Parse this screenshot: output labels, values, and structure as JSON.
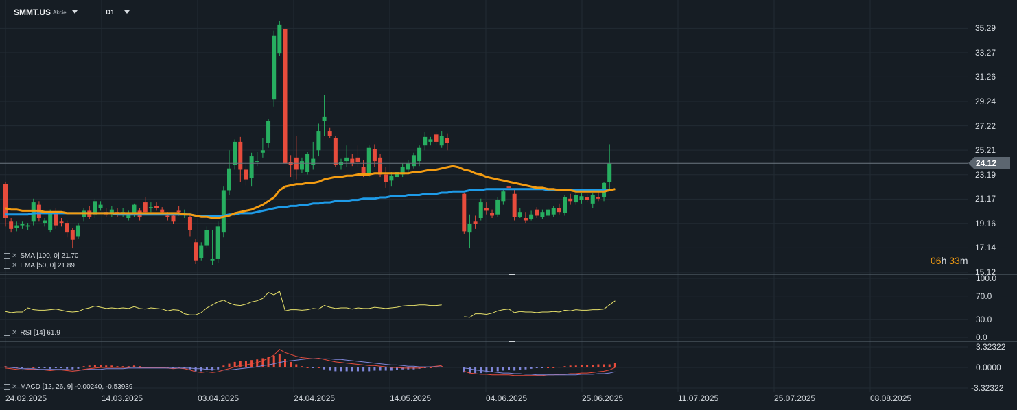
{
  "header": {
    "symbol": "SMMT.US",
    "symbol_type": "Akcie",
    "timeframe": "D1",
    "countdown_hours": "06",
    "countdown_h_unit": "h",
    "countdown_minutes": "33",
    "countdown_m_unit": "m"
  },
  "indicators": {
    "sma": "SMA [100, 0] 21.70",
    "ema": "EMA [50, 0] 21.89",
    "rsi": "RSI [14] 61.9",
    "macd": "MACD [12, 26, 9] -0.00240, -0.53939"
  },
  "colors": {
    "background": "#161d24",
    "up": "#27ae60",
    "down": "#e74c3c",
    "sma": "#1e9be8",
    "ema": "#f39c12",
    "rsi": "#e6e06a",
    "macd_line": "#e74c3c",
    "signal_line": "#7f86d9",
    "grid": "#222b33",
    "current_price_line": "#6c7780"
  },
  "chart_data": {
    "type": "candlestick",
    "symbol": "SMMT.US",
    "timeframe": "D1",
    "price_axis": {
      "ticks": [
        35.29,
        33.27,
        31.26,
        29.24,
        27.22,
        25.21,
        23.19,
        21.17,
        19.16,
        17.14,
        15.12
      ],
      "range": [
        15.12,
        36.5
      ],
      "current_price": 24.12
    },
    "date_axis": {
      "labels": [
        "24.02.2025",
        "14.03.2025",
        "03.04.2025",
        "24.04.2025",
        "14.05.2025",
        "04.06.2025",
        "25.06.2025",
        "11.07.2025",
        "25.07.2025",
        "08.08.2025"
      ]
    },
    "candles": [
      [
        22.4,
        22.6,
        18.9,
        19.6
      ],
      [
        19.3,
        19.6,
        18.4,
        18.7
      ],
      [
        18.8,
        19.3,
        18.5,
        19.0
      ],
      [
        19.0,
        19.3,
        18.7,
        19.1
      ],
      [
        18.9,
        19.2,
        18.6,
        19.0
      ],
      [
        19.3,
        21.2,
        19.0,
        20.9
      ],
      [
        20.7,
        21.0,
        19.3,
        19.6
      ],
      [
        19.2,
        19.6,
        18.9,
        19.4
      ],
      [
        18.6,
        20.3,
        18.4,
        20.0
      ],
      [
        20.1,
        20.4,
        18.7,
        19.0
      ],
      [
        19.3,
        19.6,
        18.9,
        19.2
      ],
      [
        19.2,
        19.4,
        18.0,
        18.4
      ],
      [
        18.6,
        18.8,
        17.1,
        17.8
      ],
      [
        18.1,
        19.2,
        17.9,
        19.0
      ],
      [
        19.7,
        20.4,
        19.3,
        20.2
      ],
      [
        20.2,
        20.6,
        19.5,
        19.7
      ],
      [
        19.9,
        21.2,
        19.6,
        21.0
      ],
      [
        20.4,
        21.0,
        20.2,
        20.7
      ],
      [
        20.1,
        20.4,
        19.7,
        19.9
      ],
      [
        20.0,
        20.6,
        19.7,
        20.3
      ],
      [
        20.1,
        20.4,
        19.7,
        19.9
      ],
      [
        19.9,
        20.4,
        19.7,
        20.1
      ],
      [
        19.6,
        20.2,
        19.4,
        20.0
      ],
      [
        19.9,
        20.8,
        19.7,
        20.7
      ],
      [
        20.2,
        20.4,
        19.4,
        19.7
      ],
      [
        20.9,
        21.3,
        19.9,
        20.1
      ],
      [
        20.4,
        20.9,
        20.1,
        20.5
      ],
      [
        20.6,
        20.9,
        20.2,
        20.4
      ],
      [
        20.3,
        20.5,
        19.9,
        20.1
      ],
      [
        19.8,
        20.1,
        19.4,
        19.7
      ],
      [
        19.8,
        20.0,
        19.1,
        19.3
      ],
      [
        20.2,
        20.6,
        19.8,
        20.1
      ],
      [
        19.9,
        20.3,
        19.6,
        20.0
      ],
      [
        19.7,
        19.9,
        18.1,
        18.6
      ],
      [
        17.6,
        17.9,
        15.8,
        16.1
      ],
      [
        16.3,
        17.6,
        16.1,
        17.3
      ],
      [
        17.3,
        18.9,
        17.1,
        18.6
      ],
      [
        16.1,
        18.6,
        15.7,
        16.2
      ],
      [
        16.2,
        19.3,
        15.9,
        18.9
      ],
      [
        18.4,
        22.2,
        18.0,
        21.9
      ],
      [
        21.9,
        25.2,
        21.5,
        23.7
      ],
      [
        24.0,
        26.1,
        23.6,
        25.9
      ],
      [
        25.9,
        26.3,
        22.6,
        23.6
      ],
      [
        23.6,
        24.2,
        22.3,
        22.8
      ],
      [
        22.9,
        25.0,
        22.2,
        24.7
      ],
      [
        24.2,
        25.1,
        23.9,
        24.3
      ],
      [
        25.0,
        26.2,
        24.6,
        25.2
      ],
      [
        25.8,
        27.8,
        25.4,
        27.6
      ],
      [
        29.4,
        35.1,
        28.8,
        34.7
      ],
      [
        33.2,
        35.9,
        33.0,
        35.6
      ],
      [
        35.2,
        35.6,
        23.7,
        24.1
      ],
      [
        24.2,
        24.8,
        23.0,
        24.0
      ],
      [
        24.6,
        26.4,
        22.8,
        23.6
      ],
      [
        23.6,
        24.6,
        23.3,
        24.3
      ],
      [
        23.4,
        25.1,
        23.2,
        24.9
      ],
      [
        24.0,
        25.9,
        23.6,
        24.5
      ],
      [
        25.2,
        27.4,
        24.7,
        26.8
      ],
      [
        27.6,
        29.8,
        26.4,
        28.0
      ],
      [
        26.8,
        27.1,
        26.2,
        26.4
      ],
      [
        26.2,
        26.4,
        23.8,
        24.0
      ],
      [
        24.0,
        24.5,
        23.6,
        24.2
      ],
      [
        24.3,
        25.6,
        23.8,
        24.6
      ],
      [
        24.5,
        24.9,
        23.9,
        24.1
      ],
      [
        24.6,
        25.6,
        23.8,
        24.2
      ],
      [
        23.8,
        24.4,
        23.0,
        23.3
      ],
      [
        23.3,
        25.6,
        23.0,
        25.4
      ],
      [
        25.3,
        25.7,
        23.8,
        24.3
      ],
      [
        24.6,
        24.9,
        23.0,
        23.2
      ],
      [
        23.2,
        23.8,
        22.1,
        22.6
      ],
      [
        22.7,
        23.4,
        22.2,
        23.1
      ],
      [
        23.0,
        23.7,
        22.6,
        23.4
      ],
      [
        23.2,
        24.1,
        23.0,
        23.8
      ],
      [
        23.6,
        24.4,
        23.2,
        24.1
      ],
      [
        23.9,
        25.0,
        23.7,
        24.8
      ],
      [
        24.3,
        25.6,
        23.9,
        25.4
      ],
      [
        25.6,
        26.7,
        25.2,
        26.3
      ],
      [
        25.9,
        26.3,
        25.6,
        26.1
      ],
      [
        26.5,
        26.7,
        25.6,
        25.9
      ],
      [
        25.6,
        26.8,
        25.4,
        26.4
      ],
      [
        26.2,
        26.6,
        25.2,
        25.8
      ],
      [
        null,
        null,
        null,
        null
      ],
      [
        null,
        null,
        null,
        null
      ],
      [
        21.6,
        21.7,
        18.3,
        18.5
      ],
      [
        18.4,
        19.9,
        17.1,
        19.1
      ],
      [
        19.3,
        19.8,
        18.7,
        19.1
      ],
      [
        19.6,
        21.2,
        19.4,
        20.9
      ],
      [
        20.4,
        20.9,
        19.9,
        20.2
      ],
      [
        20.0,
        20.3,
        19.6,
        19.8
      ],
      [
        19.9,
        21.3,
        19.7,
        21.1
      ],
      [
        21.0,
        22.0,
        20.7,
        21.8
      ],
      [
        22.2,
        22.8,
        21.8,
        22.1
      ],
      [
        21.6,
        22.0,
        19.4,
        19.7
      ],
      [
        19.7,
        20.4,
        19.6,
        20.1
      ],
      [
        19.6,
        20.1,
        19.2,
        19.4
      ],
      [
        19.5,
        20.2,
        19.4,
        19.9
      ],
      [
        20.3,
        20.5,
        19.6,
        19.8
      ],
      [
        19.7,
        20.3,
        19.5,
        20.1
      ],
      [
        19.8,
        20.4,
        19.6,
        20.3
      ],
      [
        19.9,
        20.6,
        19.7,
        20.4
      ],
      [
        20.4,
        20.8,
        19.9,
        20.1
      ],
      [
        20.0,
        21.5,
        19.8,
        21.3
      ],
      [
        21.2,
        21.6,
        20.7,
        21.0
      ],
      [
        20.9,
        21.8,
        20.7,
        21.5
      ],
      [
        21.1,
        21.7,
        20.8,
        21.4
      ],
      [
        21.3,
        21.6,
        20.9,
        21.1
      ],
      [
        20.8,
        21.7,
        20.4,
        21.5
      ],
      [
        21.3,
        21.8,
        21.0,
        21.2
      ],
      [
        21.3,
        22.6,
        21.0,
        22.5
      ],
      [
        22.6,
        25.7,
        22.0,
        24.1
      ]
    ],
    "sma100": [
      19.9,
      19.9,
      19.9,
      19.9,
      19.9,
      20.0,
      20.0,
      20.0,
      20.0,
      20.0,
      20.0,
      20.0,
      20.0,
      20.0,
      20.0,
      20.0,
      20.0,
      20.0,
      20.0,
      20.0,
      19.9,
      19.9,
      19.9,
      19.9,
      19.9,
      19.9,
      19.9,
      19.9,
      19.9,
      19.9,
      19.9,
      19.9,
      19.9,
      19.9,
      19.8,
      19.8,
      19.8,
      19.8,
      19.8,
      19.8,
      19.9,
      19.9,
      20.0,
      20.0,
      20.0,
      20.1,
      20.2,
      20.3,
      20.4,
      20.5,
      20.5,
      20.6,
      20.6,
      20.7,
      20.7,
      20.8,
      20.8,
      20.9,
      20.9,
      21.0,
      21.0,
      21.0,
      21.1,
      21.1,
      21.2,
      21.2,
      21.2,
      21.3,
      21.3,
      21.4,
      21.4,
      21.4,
      21.5,
      21.5,
      21.5,
      21.6,
      21.6,
      21.6,
      21.7,
      21.7,
      21.8,
      21.8,
      21.8,
      21.9,
      21.9,
      21.9,
      22.0,
      22.0,
      22.0,
      22.0,
      22.0,
      22.0,
      22.0,
      22.0,
      22.0,
      22.0,
      22.0,
      21.9,
      21.9,
      21.9,
      21.9,
      21.9,
      21.9,
      21.9,
      21.9,
      21.9,
      21.9,
      21.9,
      21.9
    ],
    "ema50": [
      20.4,
      20.3,
      20.3,
      20.2,
      20.2,
      20.2,
      20.2,
      20.1,
      20.1,
      20.1,
      20.1,
      20.0,
      20.0,
      20.0,
      20.0,
      20.0,
      20.0,
      20.0,
      20.0,
      20.0,
      20.0,
      20.0,
      20.0,
      20.0,
      20.0,
      20.0,
      20.0,
      20.0,
      20.0,
      20.0,
      20.0,
      20.0,
      19.9,
      19.9,
      19.8,
      19.7,
      19.7,
      19.6,
      19.6,
      19.7,
      19.8,
      20.0,
      20.1,
      20.2,
      20.3,
      20.5,
      20.7,
      21.0,
      21.3,
      21.9,
      22.2,
      22.3,
      22.4,
      22.4,
      22.5,
      22.5,
      22.6,
      22.8,
      22.9,
      23.0,
      23.0,
      23.1,
      23.1,
      23.2,
      23.2,
      23.2,
      23.3,
      23.3,
      23.3,
      23.3,
      23.3,
      23.3,
      23.3,
      23.4,
      23.4,
      23.5,
      23.6,
      23.6,
      23.7,
      23.8,
      23.9,
      23.8,
      23.6,
      23.5,
      23.3,
      23.2,
      23.0,
      22.9,
      22.8,
      22.7,
      22.6,
      22.5,
      22.4,
      22.3,
      22.2,
      22.1,
      22.1,
      22.0,
      22.0,
      21.9,
      21.9,
      21.9,
      21.8,
      21.8,
      21.8,
      21.8,
      21.8,
      21.8,
      21.9,
      22.0
    ],
    "rsi": [
      44,
      42,
      43,
      43,
      50,
      47,
      46,
      46,
      47,
      48,
      46,
      44,
      43,
      44,
      48,
      50,
      53,
      51,
      49,
      50,
      49,
      50,
      49,
      52,
      49,
      48,
      50,
      49,
      48,
      45,
      47,
      46,
      40,
      38,
      38,
      42,
      50,
      55,
      60,
      63,
      58,
      55,
      54,
      56,
      60,
      62,
      66,
      76,
      72,
      78,
      45,
      47,
      47,
      46,
      47,
      49,
      48,
      54,
      51,
      49,
      50,
      50,
      48,
      50,
      49,
      49,
      51,
      50,
      49,
      50,
      51,
      53,
      54,
      54,
      55,
      55,
      54,
      54,
      55,
      null,
      null,
      null,
      35,
      34,
      40,
      40,
      39,
      41,
      45,
      47,
      48,
      42,
      44,
      43,
      43,
      42,
      43,
      43,
      44,
      43,
      46,
      45,
      47,
      46,
      46,
      47,
      47,
      48,
      55,
      61.9
    ],
    "rsi_axis": [
      100.0,
      70.0,
      30.0,
      0.0
    ],
    "macd_axis": [
      3.32322,
      0.0,
      -3.32322
    ],
    "macd_hist": [
      0.2,
      0.1,
      0.0,
      -0.1,
      0.1,
      0.0,
      -0.1,
      -0.1,
      -0.2,
      -0.1,
      -0.1,
      -0.2,
      -0.3,
      -0.2,
      0.2,
      0.3,
      0.4,
      0.4,
      0.3,
      0.3,
      0.2,
      0.2,
      0.2,
      0.3,
      0.2,
      0.1,
      0.1,
      0.1,
      0.1,
      0.0,
      -0.1,
      0.0,
      -0.1,
      -0.3,
      -0.6,
      -0.6,
      -0.4,
      -0.5,
      -0.3,
      0.3,
      0.6,
      0.9,
      1.0,
      1.0,
      1.2,
      1.3,
      1.5,
      1.7,
      1.9,
      2.2,
      1.4,
      0.9,
      0.5,
      0.2,
      0.0,
      -0.1,
      0.0,
      -0.3,
      -0.5,
      -0.6,
      -0.6,
      -0.6,
      -0.6,
      -0.6,
      -0.6,
      -0.6,
      -0.5,
      -0.5,
      -0.5,
      -0.5,
      -0.4,
      -0.3,
      -0.3,
      -0.3,
      -0.2,
      -0.1,
      0.0,
      0.1,
      0.2,
      null,
      null,
      null,
      -0.8,
      -0.9,
      -0.9,
      -0.9,
      -0.8,
      -0.7,
      -0.6,
      -0.5,
      -0.4,
      -0.5,
      -0.4,
      -0.3,
      -0.2,
      -0.1,
      -0.1,
      0.0,
      0.0,
      0.1,
      0.2,
      0.3,
      0.3,
      0.4,
      0.4,
      0.4,
      0.5,
      0.5,
      0.5,
      0.7
    ],
    "macd_line": [
      -0.1,
      -0.2,
      -0.3,
      -0.4,
      -0.3,
      -0.3,
      -0.3,
      -0.4,
      -0.5,
      -0.4,
      -0.4,
      -0.5,
      -0.6,
      -0.5,
      -0.3,
      -0.2,
      -0.1,
      0.0,
      0.0,
      0.0,
      0.0,
      0.0,
      0.0,
      0.1,
      0.0,
      0.0,
      0.0,
      0.0,
      0.0,
      -0.1,
      -0.2,
      -0.1,
      -0.2,
      -0.4,
      -0.7,
      -0.8,
      -0.7,
      -0.8,
      -0.7,
      -0.4,
      -0.2,
      0.1,
      0.3,
      0.4,
      0.6,
      0.8,
      1.1,
      1.5,
      2.0,
      2.9,
      2.4,
      2.1,
      1.8,
      1.6,
      1.5,
      1.4,
      1.5,
      1.3,
      1.1,
      0.9,
      0.8,
      0.7,
      0.6,
      0.5,
      0.4,
      0.3,
      0.3,
      0.2,
      0.1,
      0.0,
      0.0,
      -0.1,
      -0.1,
      -0.1,
      -0.1,
      0.0,
      0.1,
      0.2,
      0.3,
      null,
      null,
      null,
      -0.6,
      -0.9,
      -1.0,
      -1.1,
      -1.1,
      -1.2,
      -1.2,
      -1.2,
      -1.2,
      -1.3,
      -1.3,
      -1.3,
      -1.3,
      -1.3,
      -1.3,
      -1.2,
      -1.2,
      -1.1,
      -1.1,
      -1.0,
      -1.0,
      -0.9,
      -0.9,
      -0.8,
      -0.7,
      -0.6,
      -0.4,
      0.0
    ],
    "signal_line": [
      0.1,
      0.0,
      -0.1,
      -0.2,
      -0.2,
      -0.2,
      -0.3,
      -0.3,
      -0.3,
      -0.3,
      -0.3,
      -0.3,
      -0.4,
      -0.4,
      -0.4,
      -0.3,
      -0.3,
      -0.3,
      -0.2,
      -0.2,
      -0.2,
      -0.2,
      -0.1,
      -0.1,
      -0.1,
      -0.1,
      -0.1,
      -0.1,
      -0.1,
      -0.1,
      -0.1,
      -0.1,
      -0.1,
      -0.1,
      -0.2,
      -0.2,
      -0.3,
      -0.3,
      -0.4,
      -0.4,
      -0.4,
      -0.3,
      -0.2,
      -0.1,
      0.0,
      0.1,
      0.3,
      0.4,
      0.6,
      0.8,
      1.0,
      1.1,
      1.2,
      1.3,
      1.4,
      1.4,
      1.4,
      1.4,
      1.4,
      1.3,
      1.3,
      1.2,
      1.1,
      1.0,
      0.9,
      0.8,
      0.7,
      0.6,
      0.5,
      0.4,
      0.4,
      0.3,
      0.2,
      0.2,
      0.1,
      0.1,
      0.1,
      0.1,
      0.1,
      null,
      null,
      null,
      -0.1,
      -0.2,
      -0.4,
      -0.5,
      -0.6,
      -0.7,
      -0.8,
      -0.9,
      -0.9,
      -1.0,
      -1.0,
      -1.1,
      -1.1,
      -1.2,
      -1.2,
      -1.2,
      -1.2,
      -1.2,
      -1.2,
      -1.2,
      -1.2,
      -1.1,
      -1.1,
      -1.1,
      -1.0,
      -1.0,
      -0.9,
      -0.7
    ]
  }
}
